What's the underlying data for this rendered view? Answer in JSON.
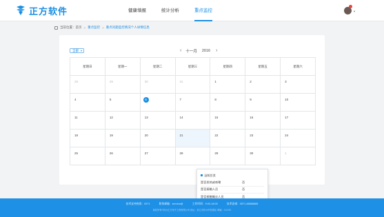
{
  "brand": {
    "name": "正方软件",
    "color": "#1a8fe3"
  },
  "nav": [
    {
      "label": "健康填报",
      "active": false
    },
    {
      "label": "统计分析",
      "active": false
    },
    {
      "label": "重点监控",
      "active": true
    }
  ],
  "user": {
    "avatar_icon": "user-avatar",
    "badge_color": "#e8433d"
  },
  "breadcrumb": {
    "prefix": "当前位置：",
    "home": "首页",
    "section": "重点监控",
    "current": "重点问题监控情况个人详情信息"
  },
  "calendar": {
    "view_select": "全部",
    "month_label": "十一月",
    "year_label": "2016",
    "weekdays": [
      "星期日",
      "星期一",
      "星期二",
      "星期三",
      "星期四",
      "星期五",
      "星期六"
    ],
    "weeks": [
      [
        "28",
        "29",
        "30",
        "31",
        "1",
        "2",
        "3"
      ],
      [
        "4",
        "5",
        "6",
        "7",
        "8",
        "9",
        "10"
      ],
      [
        "11",
        "12",
        "13",
        "14",
        "15",
        "16",
        "17"
      ],
      [
        "18",
        "19",
        "20",
        "21",
        "22",
        "23",
        "24"
      ],
      [
        "25",
        "26",
        "27",
        "28",
        "29",
        "30",
        "1"
      ]
    ],
    "today": "6",
    "selected": "21"
  },
  "popup": {
    "title": "当前总览",
    "rows": [
      {
        "key": "是否发热或咳嗽",
        "value": "否"
      },
      {
        "key": "是否接触人员",
        "value": "否"
      },
      {
        "key": "是否接触确诊人员",
        "value": "否"
      },
      {
        "key": "目前是否身体状况健康",
        "value": "否"
      },
      {
        "key": "家庭所在地",
        "value": "杭州"
      }
    ]
  },
  "footer": {
    "items": [
      "技术支持热线：0571",
      "联系邮箱：service@",
      "工作时间：9:00-18:00",
      "技术咨询：0571-88888888"
    ],
    "copyright": "版权所有©杭州正方电子工程有限公司   地址：浙江省杭州市西湖区   邮编：310000"
  }
}
